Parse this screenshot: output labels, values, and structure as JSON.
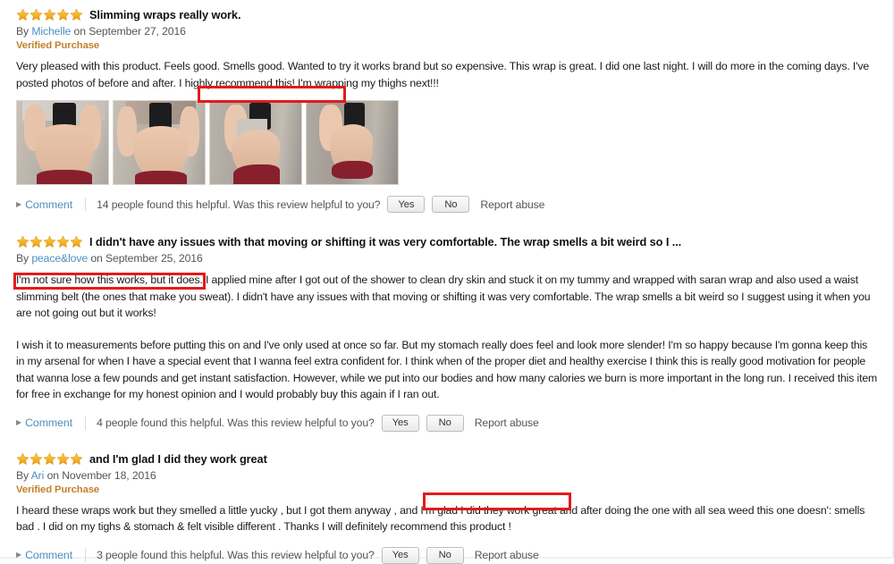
{
  "page": {
    "accent_link": "#4a8fc0",
    "verified_color": "#c4802b",
    "star_color": "#f5a623",
    "highlight_color": "#e21b1b"
  },
  "reviews": [
    {
      "rating": 5,
      "stars_label": "5.0 out of 5 stars",
      "title": "Slimming wraps really work.",
      "by_prefix": "By",
      "author": "Michelle",
      "on_prefix": "on",
      "date": "September 27, 2016",
      "verified": "Verified Purchase",
      "paragraphs": [
        "Very pleased with this product. Feels good. Smells good. Wanted to try it works brand but so expensive. This wrap is great. I did one last night. I will do more in the coming days. I've posted photos of before and after. I highly recommend this! I'm wrapping my thighs next!!!"
      ],
      "highlight_text": "highly recommend this!",
      "photos": [
        {
          "alt": "before photo front view"
        },
        {
          "alt": "after photo front view"
        },
        {
          "alt": "before photo side view"
        },
        {
          "alt": "after photo side view"
        }
      ],
      "helpful": {
        "comment": "Comment",
        "count_text": "14 people found this helpful. Was this review helpful to you?",
        "yes": "Yes",
        "no": "No",
        "report": "Report abuse"
      }
    },
    {
      "rating": 5,
      "stars_label": "5.0 out of 5 stars",
      "title": "I didn't have any issues with that moving or shifting it was very comfortable. The wrap smells a bit weird so I ...",
      "by_prefix": "By",
      "author": "peace&love",
      "on_prefix": "on",
      "date": "September 25, 2016",
      "verified": "",
      "paragraphs": [
        "I'm not sure how this works, but it does. I applied mine after I got out of the shower to clean dry skin and stuck it on my tummy and wrapped with saran wrap and also used a waist slimming belt (the ones that make you sweat). I didn't have any issues with that moving or shifting it was very comfortable. The wrap smells a bit weird so I suggest using it when you are not going out but it works!",
        "I wish it to measurements before putting this on and I've only used at once so far. But my stomach really does feel and look more slender! I'm so happy because I'm gonna keep this in my arsenal for when I have a special event that I wanna feel extra confident for. I think when of the proper diet and healthy exercise I think this is really good motivation for people that wanna lose a few pounds and get instant satisfaction. However, while we put into our bodies and how many calories we burn is more important in the long run. I received this item for free in exchange for my honest opinion and I would probably buy this again if I ran out."
      ],
      "highlight_text": "I'm not sure how this works, but it does.",
      "photos": [],
      "helpful": {
        "comment": "Comment",
        "count_text": "4 people found this helpful. Was this review helpful to you?",
        "yes": "Yes",
        "no": "No",
        "report": "Report abuse"
      }
    },
    {
      "rating": 5,
      "stars_label": "5.0 out of 5 stars",
      "title": "and I'm glad I did they work great",
      "by_prefix": "By",
      "author": "Ari",
      "on_prefix": "on",
      "date": "November 18, 2016",
      "verified": "Verified Purchase",
      "paragraphs": [
        "I heard these wraps work but they smelled a little yucky , but I got them anyway , and I'm glad I did they work great  and after doing the one with all sea weed this one doesn': smells bad . I did on my tighs & stomach & felt visible different . Thanks I will definitely recommend this product !"
      ],
      "highlight_text": "I'm glad I did they work great",
      "photos": [],
      "helpful": {
        "comment": "Comment",
        "count_text": "3 people found this helpful. Was this review helpful to you?",
        "yes": "Yes",
        "no": "No",
        "report": "Report abuse"
      }
    }
  ]
}
